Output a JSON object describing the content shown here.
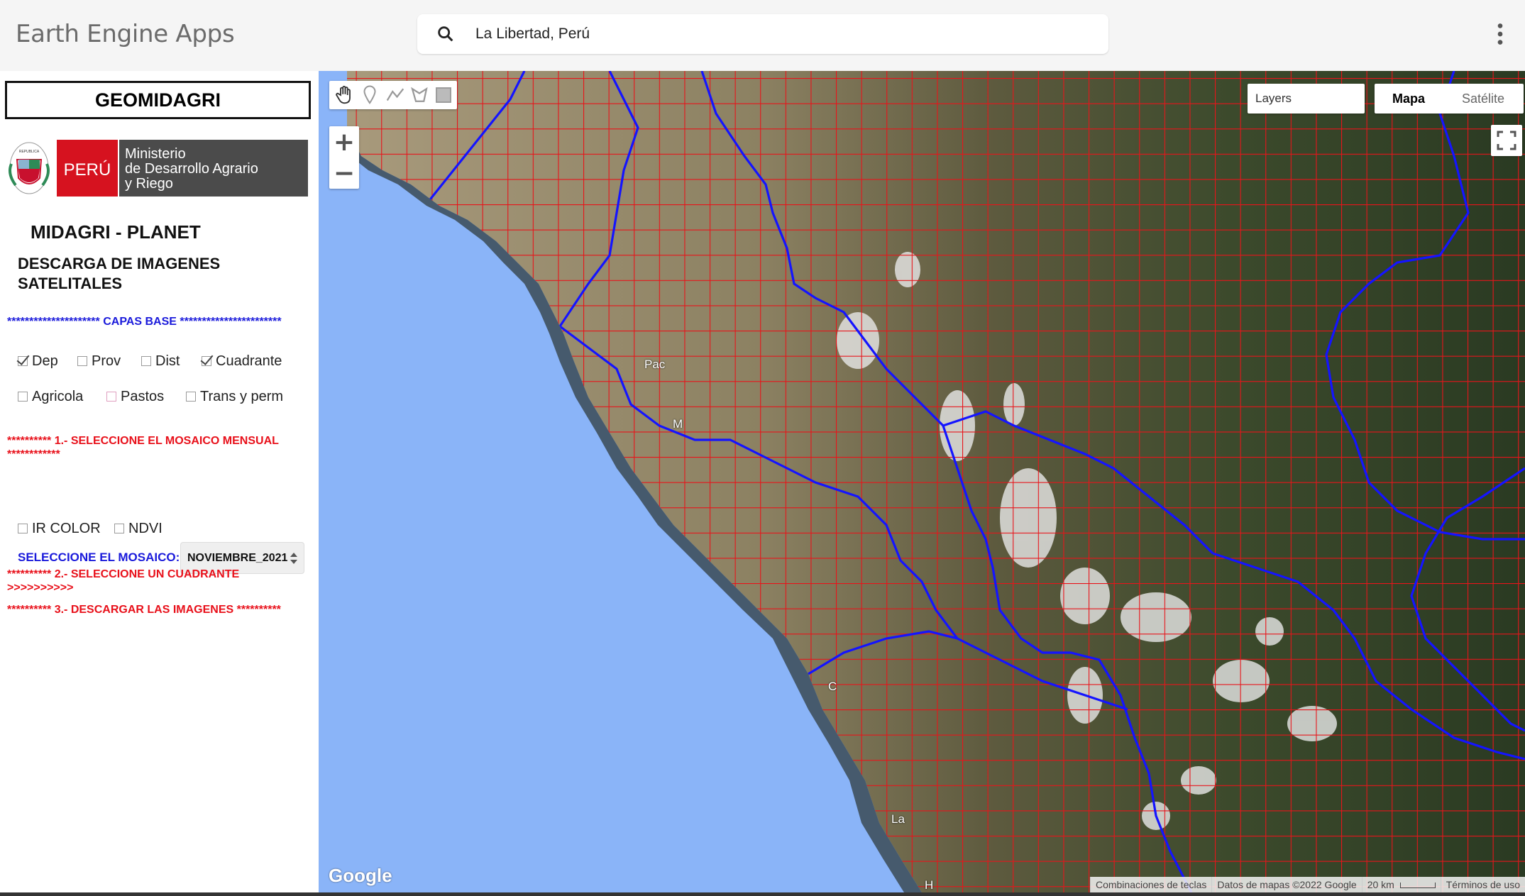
{
  "header": {
    "app_title": "Earth Engine Apps",
    "search_value": "La Libertad, Perú"
  },
  "sidebar": {
    "title": "GEOMIDAGRI",
    "logo": {
      "country": "PERÚ",
      "ministry_line1": "Ministerio",
      "ministry_line2": "de Desarrollo Agrario",
      "ministry_line3": "y Riego"
    },
    "subtitle": "MIDAGRI - PLANET",
    "description": "DESCARGA DE IMAGENES SATELITALES",
    "capas_header": "********************* CAPAS BASE ***********************",
    "layers_row1": [
      {
        "label": "Dep",
        "checked": true
      },
      {
        "label": "Prov",
        "checked": false
      },
      {
        "label": "Dist",
        "checked": false
      },
      {
        "label": "Cuadrante",
        "checked": true
      }
    ],
    "layers_row2": [
      {
        "label": "Agricola",
        "checked": false
      },
      {
        "label": "Pastos",
        "checked": false
      },
      {
        "label": "Trans y perm",
        "checked": false
      }
    ],
    "step1": "********** 1.- SELECCIONE EL MOSAICO MENSUAL ************",
    "mosaic_label": "SELECCIONE EL MOSAICO:",
    "mosaic_value": "NOVIEMBRE_2021",
    "bands": [
      {
        "label": "IR COLOR",
        "checked": false
      },
      {
        "label": "NDVI",
        "checked": false
      }
    ],
    "step2": "********** 2.- SELECCIONE UN CUADRANTE >>>>>>>>>>",
    "step3": "********** 3.- DESCARGAR LAS IMAGENES **********"
  },
  "map": {
    "layers_label": "Layers",
    "map_type_active": "Mapa",
    "map_type_inactive": "Satélite",
    "google_logo": "Google",
    "footer": {
      "shortcuts": "Combinaciones de teclas",
      "data": "Datos de mapas ©2022 Google",
      "scale": "20 km",
      "terms": "Términos de uso"
    },
    "place_labels": [
      "Pac",
      "M",
      "C",
      "La",
      "H"
    ],
    "colors": {
      "grid": "#e8141a",
      "boundary": "#1414ff",
      "ocean": "#8ab4f8"
    }
  }
}
